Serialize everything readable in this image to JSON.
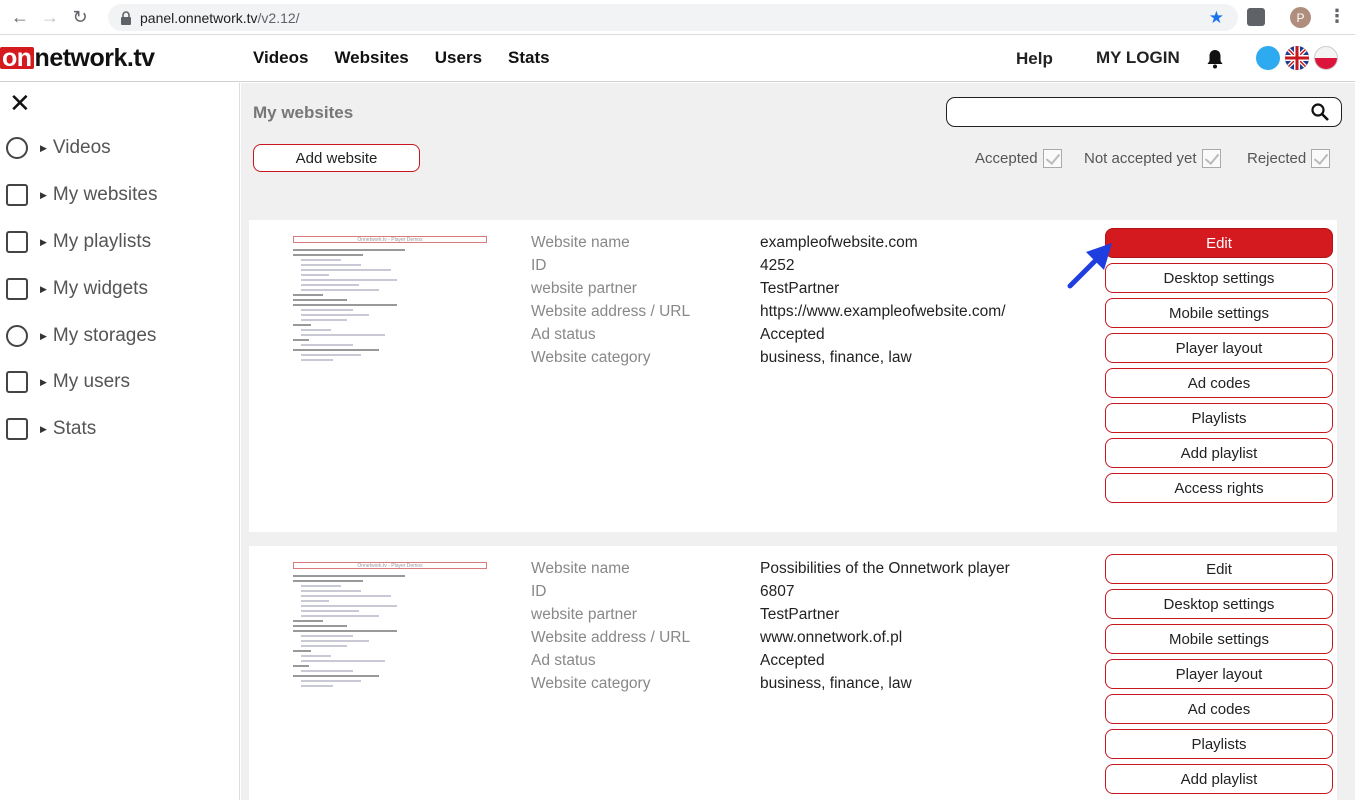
{
  "browser": {
    "url_host": "panel.onnetwork.tv",
    "url_path": "/v2.12/",
    "profile_initial": "P"
  },
  "header": {
    "logo_on": "on",
    "logo_rest": "network.tv",
    "nav": [
      "Videos",
      "Websites",
      "Users",
      "Stats"
    ],
    "help": "Help",
    "login": "MY LOGIN"
  },
  "sidebar": {
    "items": [
      {
        "label": "Videos",
        "icon": "camera-icon"
      },
      {
        "label": "My websites",
        "icon": "website-icon"
      },
      {
        "label": "My playlists",
        "icon": "playlist-icon"
      },
      {
        "label": "My widgets",
        "icon": "widget-icon"
      },
      {
        "label": "My storages",
        "icon": "storage-icon"
      },
      {
        "label": "My users",
        "icon": "users-icon"
      },
      {
        "label": "Stats",
        "icon": "stats-icon"
      }
    ]
  },
  "main": {
    "title": "My websites",
    "add_website": "Add website",
    "filters": [
      "Accepted",
      "Not accepted yet",
      "Rejected"
    ],
    "thumb_title": "Onnetwork.tv - Player Demos",
    "field_labels": [
      "Website name",
      "ID",
      "website partner",
      "Website address / URL",
      "Ad status",
      "Website category"
    ],
    "cards": [
      {
        "values": [
          "exampleofwebsite.com",
          "4252",
          "TestPartner",
          "https://www.exampleofwebsite.com/",
          "Accepted",
          "business, finance, law"
        ],
        "actions": [
          "Edit",
          "Desktop settings",
          "Mobile settings",
          "Player layout",
          "Ad codes",
          "Playlists",
          "Add playlist",
          "Access rights"
        ]
      },
      {
        "values": [
          "Possibilities of the Onnetwork player",
          "6807",
          "TestPartner",
          "www.onnetwork.of.pl",
          "Accepted",
          "business, finance, law"
        ],
        "actions": [
          "Edit",
          "Desktop settings",
          "Mobile settings",
          "Player layout",
          "Ad codes",
          "Playlists",
          "Add playlist"
        ]
      }
    ]
  },
  "colors": {
    "brand_red": "#d4191f",
    "pointer_blue": "#1f3ee0"
  }
}
